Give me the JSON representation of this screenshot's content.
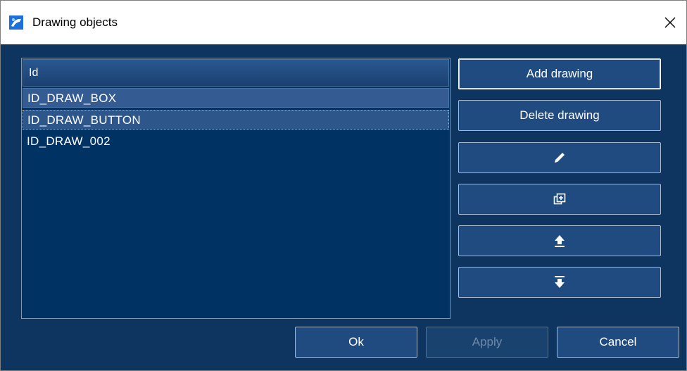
{
  "window": {
    "title": "Drawing objects",
    "close_glyph": "✕"
  },
  "list": {
    "header": "Id",
    "items": [
      {
        "label": "ID_DRAW_BOX",
        "state": "selected"
      },
      {
        "label": "ID_DRAW_BUTTON",
        "state": "selected-focused"
      },
      {
        "label": "ID_DRAW_002",
        "state": "normal"
      }
    ]
  },
  "side_buttons": {
    "add_label": "Add drawing",
    "delete_label": "Delete drawing",
    "edit_icon": "pencil-icon",
    "duplicate_icon": "duplicate-icon",
    "move_up_icon": "move-up-icon",
    "move_bottom_icon": "move-to-bottom-icon"
  },
  "footer": {
    "ok_label": "Ok",
    "apply_label": "Apply",
    "cancel_label": "Cancel"
  },
  "colors": {
    "background": "#0d3560",
    "list_background": "#003264",
    "button": "#1f4b80",
    "selected_row": "#345c93",
    "focus_outline": "#e3a45b"
  }
}
